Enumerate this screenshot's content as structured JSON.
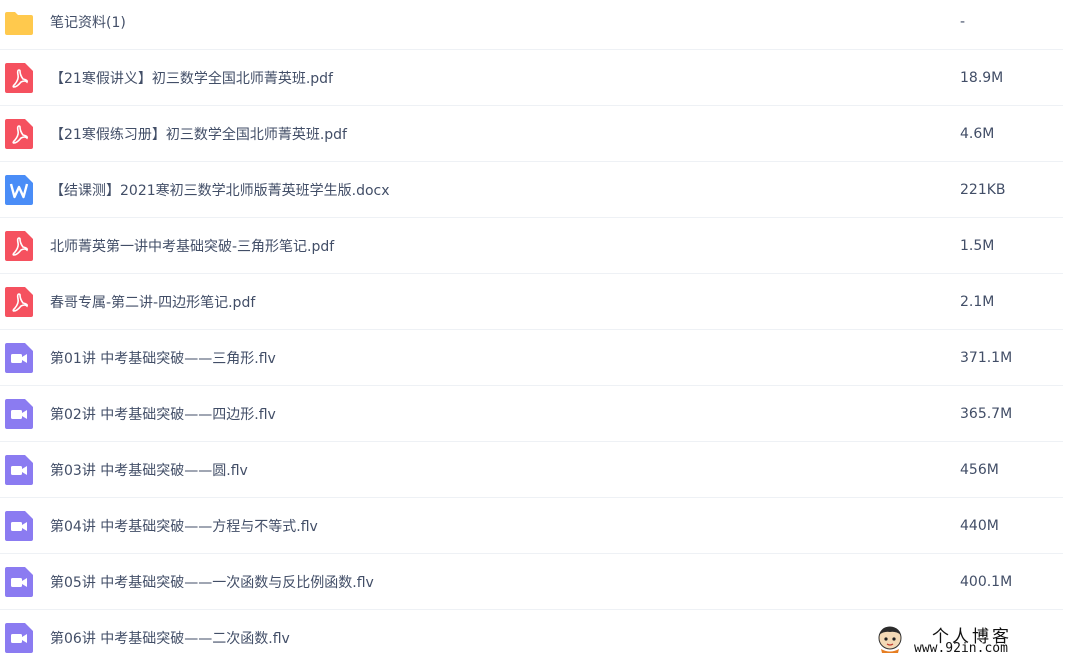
{
  "files": [
    {
      "name": "笔记资料(1)",
      "size": "-",
      "icon": "folder-icon",
      "type": "folder"
    },
    {
      "name": "【21寒假讲义】初三数学全国北师菁英班.pdf",
      "size": "18.9M",
      "icon": "pdf-icon",
      "type": "pdf"
    },
    {
      "name": "【21寒假练习册】初三数学全国北师菁英班.pdf",
      "size": "4.6M",
      "icon": "pdf-icon",
      "type": "pdf"
    },
    {
      "name": "【结课测】2021寒初三数学北师版菁英班学生版.docx",
      "size": "221KB",
      "icon": "word-icon",
      "type": "docx"
    },
    {
      "name": "北师菁英第一讲中考基础突破-三角形笔记.pdf",
      "size": "1.5M",
      "icon": "pdf-icon",
      "type": "pdf"
    },
    {
      "name": "春哥专属-第二讲-四边形笔记.pdf",
      "size": "2.1M",
      "icon": "pdf-icon",
      "type": "pdf"
    },
    {
      "name": "第01讲 中考基础突破——三角形.flv",
      "size": "371.1M",
      "icon": "video-icon",
      "type": "video"
    },
    {
      "name": "第02讲 中考基础突破——四边形.flv",
      "size": "365.7M",
      "icon": "video-icon",
      "type": "video"
    },
    {
      "name": "第03讲 中考基础突破——圆.flv",
      "size": "456M",
      "icon": "video-icon",
      "type": "video"
    },
    {
      "name": "第04讲 中考基础突破——方程与不等式.flv",
      "size": "440M",
      "icon": "video-icon",
      "type": "video"
    },
    {
      "name": "第05讲 中考基础突破——一次函数与反比例函数.flv",
      "size": "400.1M",
      "icon": "video-icon",
      "type": "video"
    },
    {
      "name": "第06讲 中考基础突破——二次函数.flv",
      "size": "",
      "icon": "video-icon",
      "type": "video"
    }
  ],
  "watermark": {
    "title": "个人博客",
    "url": "www.92in.com"
  },
  "colors": {
    "text": "#424e67",
    "folder": "#ffc94d",
    "pdf": "#f5515f",
    "word": "#4a8df7",
    "video": "#8b7bf1",
    "divider": "#eef1f5"
  }
}
